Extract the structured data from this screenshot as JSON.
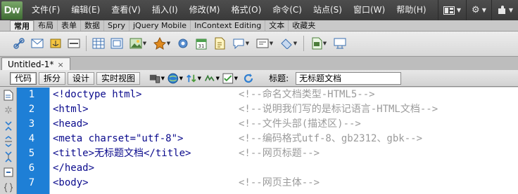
{
  "app": {
    "logo": "Dw"
  },
  "menu": [
    "文件(F)",
    "编辑(E)",
    "查看(V)",
    "插入(I)",
    "修改(M)",
    "格式(O)",
    "命令(C)",
    "站点(S)",
    "窗口(W)",
    "帮助(H)"
  ],
  "menu_right": [
    {
      "icon": "layout-icon"
    },
    {
      "icon": "gear-icon"
    },
    {
      "icon": "extension-icon"
    }
  ],
  "insert": {
    "tabs": [
      "常用",
      "布局",
      "表单",
      "数据",
      "Spry",
      "jQuery Mobile",
      "InContext Editing",
      "文本",
      "收藏夹"
    ],
    "active_tab": "常用"
  },
  "document_tab": {
    "name": "Untitled-1*",
    "close": "×"
  },
  "doc_toolbar": {
    "views": [
      "代码",
      "拆分",
      "设计",
      "实时视图"
    ],
    "active_view": "代码",
    "title_label": "标题:",
    "title_value": "无标题文档"
  },
  "code_lines": [
    {
      "num": "1",
      "code": "<!doctype html>",
      "comment": "<!--命名文档类型-HTML5-->"
    },
    {
      "num": "2",
      "code": "<html>",
      "comment": "<!--说明我们写的是标记语言-HTML文档-->"
    },
    {
      "num": "3",
      "code": "<head>",
      "comment": "<!--文件头部(描述区)-->"
    },
    {
      "num": "4",
      "code": "<meta charset=\"utf-8\">",
      "comment": "<!--编码格式utf-8、gb2312、gbk-->"
    },
    {
      "num": "5",
      "code": "<title>无标题文档</title>",
      "comment": "<!--网页标题-->"
    },
    {
      "num": "6",
      "code": "</head>",
      "comment": ""
    },
    {
      "num": "7",
      "code": "<body>",
      "comment": "<!--网页主体-->"
    }
  ],
  "colors": {
    "gutter": "#1e7fd6",
    "code_text": "#0a0a8c",
    "comment_text": "#9a9a9a",
    "menubar": "#444444"
  }
}
